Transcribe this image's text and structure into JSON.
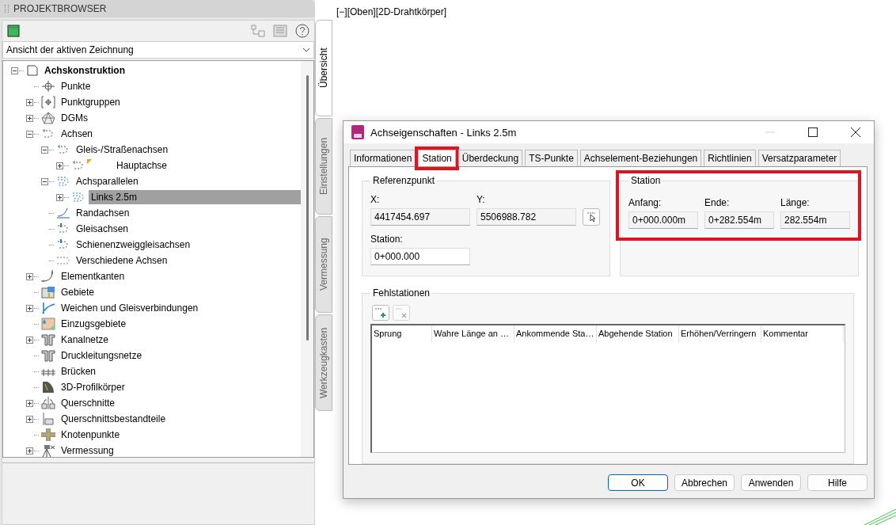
{
  "browser": {
    "title": "PROJEKTBROWSER",
    "view_select": {
      "value": "Ansicht der aktiven Zeichnung"
    },
    "tree": [
      {
        "label": "Achskonstruktion",
        "kind": "drawing",
        "expanded": true,
        "selected": false,
        "children": [
          {
            "label": "Punkte",
            "kind": "points",
            "selected": false
          },
          {
            "label": "Punktgruppen",
            "kind": "pointgroups",
            "expanded": false,
            "selected": false
          },
          {
            "label": "DGMs",
            "kind": "surface",
            "expanded": false,
            "selected": false
          },
          {
            "label": "Achsen",
            "kind": "alignment",
            "expanded": true,
            "selected": false,
            "children": [
              {
                "label": "Gleis-/Straßenachsen",
                "kind": "alignment",
                "expanded": true,
                "selected": false,
                "children": [
                  {
                    "label": "Hauptachse",
                    "kind": "alignment",
                    "expanded": false,
                    "flagged": true,
                    "selected": false
                  }
                ]
              },
              {
                "label": "Achsparallelen",
                "kind": "offset",
                "expanded": true,
                "selected": false,
                "children": [
                  {
                    "label": "Links 2.5m",
                    "kind": "offset",
                    "expanded": false,
                    "flagged": false,
                    "selected": true
                  }
                ]
              },
              {
                "label": "Randachsen",
                "kind": "curb",
                "selected": false
              },
              {
                "label": "Gleisachsen",
                "kind": "rail",
                "selected": false
              },
              {
                "label": "Schienenzweiggleisachsen",
                "kind": "rail",
                "selected": false
              },
              {
                "label": "Verschiedene Achsen",
                "kind": "misc",
                "selected": false
              }
            ]
          },
          {
            "label": "Elementkanten",
            "kind": "featureline",
            "expanded": false,
            "selected": false
          },
          {
            "label": "Gebiete",
            "kind": "site",
            "selected": false
          },
          {
            "label": "Weichen und Gleisverbindungen",
            "kind": "turnout",
            "expanded": false,
            "selected": false
          },
          {
            "label": "Einzugsgebiete",
            "kind": "catchment",
            "selected": false
          },
          {
            "label": "Kanalnetze",
            "kind": "pipe",
            "expanded": false,
            "selected": false
          },
          {
            "label": "Druckleitungsnetze",
            "kind": "pipe",
            "selected": false
          },
          {
            "label": "Brücken",
            "kind": "bridge",
            "selected": false
          },
          {
            "label": "3D-Profilkörper",
            "kind": "corridor",
            "selected": false
          },
          {
            "label": "Querschnitte",
            "kind": "assembly",
            "expanded": false,
            "selected": false
          },
          {
            "label": "Querschnittsbestandteile",
            "kind": "subassembly",
            "expanded": false,
            "selected": false
          },
          {
            "label": "Knotenpunkte",
            "kind": "intersection",
            "selected": false
          },
          {
            "label": "Vermessung",
            "kind": "survey",
            "expanded": false,
            "selected": false
          }
        ]
      }
    ],
    "side_tabs": [
      {
        "label": "Übersicht",
        "selected": true
      },
      {
        "label": "Einstellungen",
        "selected": false
      },
      {
        "label": "Vermessung",
        "selected": false
      },
      {
        "label": "Werkzeugkasten",
        "selected": false
      }
    ]
  },
  "viewport": {
    "label": "[−][Oben][2D-Drahtkörper]"
  },
  "dialog": {
    "title": "Achseigenschaften - Links 2.5m",
    "tabs": [
      {
        "label": "Informationen",
        "selected": false,
        "highlighted": false
      },
      {
        "label": "Station",
        "selected": true,
        "highlighted": true
      },
      {
        "label": "Überdeckung",
        "selected": false,
        "highlighted": false
      },
      {
        "label": "TS-Punkte",
        "selected": false,
        "highlighted": false
      },
      {
        "label": "Achselement-Beziehungen",
        "selected": false,
        "highlighted": false
      },
      {
        "label": "Richtlinien",
        "selected": false,
        "highlighted": false
      },
      {
        "label": "Versatzparameter",
        "selected": false,
        "highlighted": false
      }
    ],
    "reference": {
      "title": "Referenzpunkt",
      "x_label": "X:",
      "x_value": "4417454.697",
      "y_label": "Y:",
      "y_value": "5506988.782",
      "station_label": "Station:",
      "station_value": "0+000.000"
    },
    "station": {
      "title": "Station",
      "highlighted": true,
      "fields": [
        {
          "label": "Anfang:",
          "value": "0+000.000m"
        },
        {
          "label": "Ende:",
          "value": "0+282.554m"
        },
        {
          "label": "Länge:",
          "value": "282.554m"
        }
      ]
    },
    "gaps": {
      "title": "Fehlstationen",
      "columns": [
        "Sprung",
        "Wahre Länge an …",
        "Ankommende Sta…",
        "Abgehende Station",
        "Erhöhen/Verringern",
        "Kommentar"
      ]
    },
    "buttons": [
      {
        "label": "OK",
        "selected": true
      },
      {
        "label": "Abbrechen",
        "selected": false
      },
      {
        "label": "Anwenden",
        "selected": false
      },
      {
        "label": "Hilfe",
        "selected": false
      }
    ]
  }
}
